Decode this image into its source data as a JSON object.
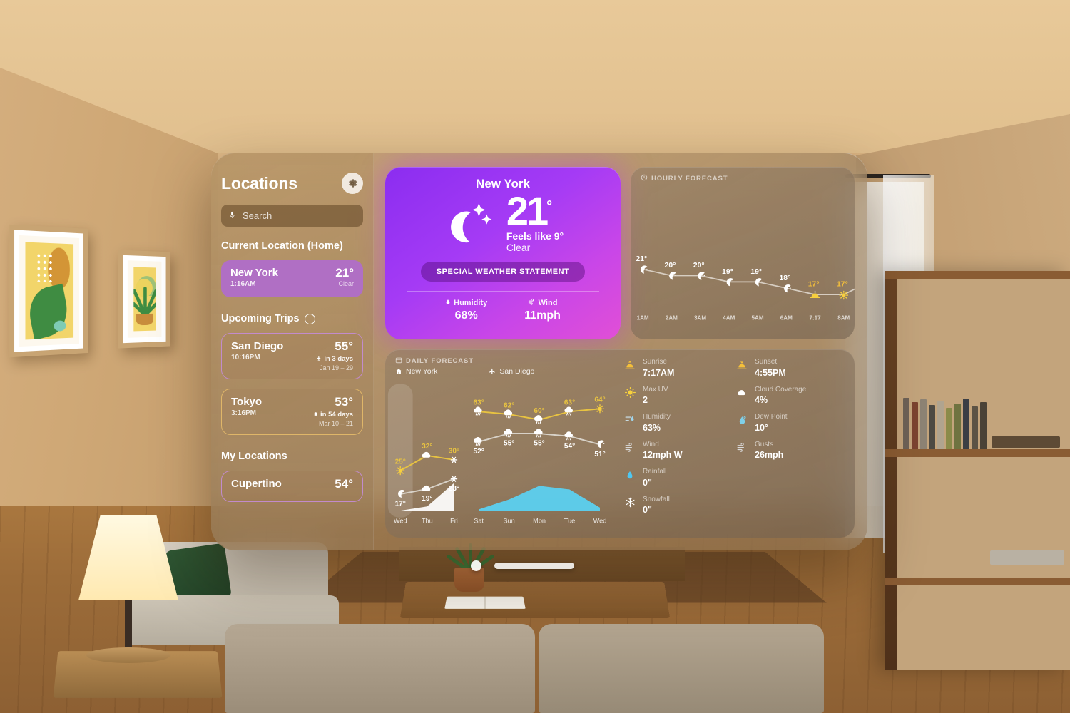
{
  "sidebar": {
    "title": "Locations",
    "gear_icon": "gear-icon",
    "search": {
      "placeholder": "Search",
      "mic_icon": "microphone-icon"
    },
    "sections": [
      {
        "heading": "Current Location (Home)",
        "has_add": false
      },
      {
        "heading": "Upcoming Trips",
        "has_add": true
      },
      {
        "heading": "My Locations",
        "has_add": false
      }
    ],
    "current": {
      "name": "New York",
      "time": "1:16AM",
      "temp": "21°",
      "condition": "Clear",
      "style": "filled"
    },
    "trips": [
      {
        "name": "San Diego",
        "time": "10:16PM",
        "temp": "55°",
        "countdown": "in 3 days",
        "dates": "Jan 19 – 29",
        "icon": "airplane-icon",
        "style": "outline-purple"
      },
      {
        "name": "Tokyo",
        "time": "3:16PM",
        "temp": "53°",
        "countdown": "in 54 days",
        "dates": "Mar 10 – 21",
        "icon": "suitcase-icon",
        "style": "outline-gold"
      }
    ],
    "my_locations": [
      {
        "name": "Cupertino",
        "temp": "54°",
        "style": "outline-purple"
      }
    ]
  },
  "current_conditions": {
    "city": "New York",
    "icon": "moon-stars-icon",
    "temp": "21",
    "degree": "°",
    "feels_like": "Feels like 9°",
    "condition": "Clear",
    "alert_label": "SPECIAL WEATHER STATEMENT",
    "stats": [
      {
        "label": "Humidity",
        "value": "68%",
        "icon": "humidity-icon"
      },
      {
        "label": "Wind",
        "value": "11mph",
        "icon": "wind-icon"
      }
    ],
    "accent": "#b83cf0"
  },
  "hourly": {
    "heading": "HOURLY FORECAST",
    "heading_icon": "clock-icon"
  },
  "daily": {
    "heading": "DAILY FORECAST",
    "heading_icon": "calendar-icon",
    "tabs": [
      {
        "label": "New York",
        "icon": "home-icon"
      },
      {
        "label": "San Diego",
        "icon": "airplane-icon"
      }
    ]
  },
  "details": {
    "left": [
      {
        "label": "Sunrise",
        "value": "7:17AM",
        "icon": "sunrise-icon",
        "color": "#f5c03a"
      },
      {
        "label": "Max UV",
        "value": "2",
        "icon": "sun-icon",
        "color": "#f7d13d"
      },
      {
        "label": "Humidity",
        "value": "63%",
        "icon": "humidity-icon",
        "color": "#9fd6ee"
      },
      {
        "label": "Wind",
        "value": "12mph W",
        "icon": "wind-icon",
        "color": "#d9d9d9"
      },
      {
        "label": "Rainfall",
        "value": "0\"",
        "icon": "raindrop-icon",
        "color": "#4fc7f0"
      },
      {
        "label": "Snowfall",
        "value": "0\"",
        "icon": "snowflake-icon",
        "color": "#ffffff"
      }
    ],
    "right": [
      {
        "label": "Sunset",
        "value": "4:55PM",
        "icon": "sunset-icon",
        "color": "#f5c03a"
      },
      {
        "label": "Cloud Coverage",
        "value": "4%",
        "icon": "cloud-icon",
        "color": "#ffffff"
      },
      {
        "label": "Dew Point",
        "value": "10°",
        "icon": "dewpoint-icon",
        "color": "#7fcfe8"
      },
      {
        "label": "Gusts",
        "value": "26mph",
        "icon": "wind-icon",
        "color": "#d9d9d9"
      }
    ]
  },
  "window_controls": {
    "close_icon": "close-dot",
    "grabber_icon": "window-grabber"
  },
  "chart_data": [
    {
      "type": "line",
      "id": "hourly-forecast",
      "title": "HOURLY FORECAST",
      "x": [
        "1AM",
        "2AM",
        "3AM",
        "4AM",
        "5AM",
        "6AM",
        "7:17",
        "8AM"
      ],
      "values": [
        21,
        20,
        20,
        19,
        19,
        18,
        17,
        17
      ],
      "labels": [
        "21°",
        "20°",
        "20°",
        "19°",
        "19°",
        "18°",
        "17°",
        "17°"
      ],
      "point_icons": [
        "moon",
        "moon",
        "moon",
        "moon",
        "moon",
        "moon",
        "sunrise",
        "sun"
      ],
      "label_colors": [
        "#ffffff",
        "#ffffff",
        "#ffffff",
        "#ffffff",
        "#ffffff",
        "#ffffff",
        "#f5c03a",
        "#f5c03a"
      ],
      "ylim": [
        16,
        22
      ],
      "grid": false,
      "xlabel": "",
      "ylabel": ""
    },
    {
      "type": "line",
      "id": "daily-forecast-new-york",
      "title": "DAILY FORECAST — New York",
      "categories": [
        "Wed",
        "Thu",
        "Fri"
      ],
      "series": [
        {
          "name": "High",
          "values": [
            25,
            32,
            30
          ],
          "labels": [
            "25°",
            "32°",
            "30°"
          ],
          "color": "#e8c341"
        },
        {
          "name": "Low",
          "values": [
            17,
            19,
            23
          ],
          "labels": [
            "17°",
            "19°",
            "23°"
          ],
          "color": "#d8d2c8"
        }
      ],
      "high_icons": [
        "sun",
        "cloud",
        "snow"
      ],
      "low_icons": [
        "moon",
        "cloud",
        "snow"
      ],
      "precip_area": {
        "name": "Snowfall",
        "values": [
          0,
          0.15,
          1.0
        ],
        "color": "#ffffff"
      },
      "ylim": [
        15,
        34
      ]
    },
    {
      "type": "line",
      "id": "daily-forecast-san-diego",
      "title": "DAILY FORECAST — San Diego",
      "categories": [
        "Sat",
        "Sun",
        "Mon",
        "Tue",
        "Wed"
      ],
      "series": [
        {
          "name": "High",
          "values": [
            63,
            62,
            60,
            63,
            64
          ],
          "labels": [
            "63°",
            "62°",
            "60°",
            "63°",
            "64°"
          ],
          "color": "#e8c341"
        },
        {
          "name": "Low",
          "values": [
            52,
            55,
            55,
            54,
            51
          ],
          "labels": [
            "52°",
            "55°",
            "55°",
            "54°",
            "51°"
          ],
          "color": "#d8d2c8"
        }
      ],
      "high_icons": [
        "rain",
        "rain",
        "rain",
        "rain",
        "sun"
      ],
      "low_icons": [
        "rain",
        "rain",
        "rain",
        "rain",
        "moon"
      ],
      "precip_area": {
        "name": "Rainfall",
        "values": [
          0.05,
          0.45,
          1.0,
          0.85,
          0.12
        ],
        "color": "#5ad2f5"
      },
      "ylim": [
        50,
        66
      ]
    }
  ]
}
